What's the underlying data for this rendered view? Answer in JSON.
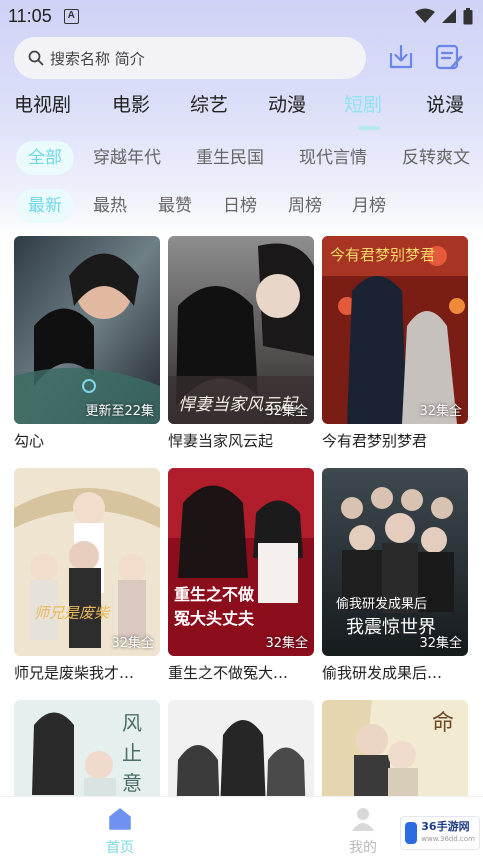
{
  "status_bar": {
    "time": "11:05",
    "notification_glyph": "A",
    "icons": [
      "wifi-icon",
      "signal-icon",
      "battery-icon"
    ]
  },
  "search": {
    "placeholder": "搜索名称 简介"
  },
  "header_icons": [
    "download-icon",
    "edit-list-icon"
  ],
  "category_tabs": [
    {
      "label": "电视剧",
      "active": false
    },
    {
      "label": "电影",
      "active": false
    },
    {
      "label": "综艺",
      "active": false
    },
    {
      "label": "动漫",
      "active": false
    },
    {
      "label": "短剧",
      "active": true
    },
    {
      "label": "说漫",
      "active": false
    }
  ],
  "genre_chips": [
    {
      "label": "全部",
      "active": true
    },
    {
      "label": "穿越年代",
      "active": false
    },
    {
      "label": "重生民国",
      "active": false
    },
    {
      "label": "现代言情",
      "active": false
    },
    {
      "label": "反转爽文",
      "active": false
    }
  ],
  "sort_chips": [
    {
      "label": "最新",
      "active": true
    },
    {
      "label": "最热",
      "active": false
    },
    {
      "label": "最赞",
      "active": false
    },
    {
      "label": "日榜",
      "active": false
    },
    {
      "label": "周榜",
      "active": false
    },
    {
      "label": "月榜",
      "active": false
    }
  ],
  "dramas": [
    {
      "title": "勾心",
      "badge": "更新至22集",
      "poster_text": "",
      "colors": [
        "#c7a47a",
        "#5a4a3f",
        "#2a2a2a"
      ]
    },
    {
      "title": "悍妻当家风云起",
      "badge": "32集全",
      "poster_text": "悍妻当家风云起",
      "colors": [
        "#8a8a8a",
        "#4a4040",
        "#d9d0c8"
      ]
    },
    {
      "title": "今有君梦别梦君",
      "badge": "32集全",
      "poster_text": "今有君梦别梦君",
      "colors": [
        "#b33a2a",
        "#1e2a3a",
        "#e2c35a"
      ]
    },
    {
      "title": "师兄是废柴我才…",
      "badge": "32集全",
      "poster_text": "师兄是废柴",
      "colors": [
        "#efe6d3",
        "#c89d6a",
        "#3b3b3b"
      ]
    },
    {
      "title": "重生之不做冤大…",
      "badge": "32集全",
      "poster_text": "重生之不做冤大头丈夫",
      "colors": [
        "#8c0d1c",
        "#d43040",
        "#f0e6e6"
      ]
    },
    {
      "title": "偷我研发成果后…",
      "badge": "32集全",
      "poster_text": "偷我研发成果后我震惊世界",
      "colors": [
        "#20282c",
        "#52616b",
        "#d2d6d8"
      ]
    },
    {
      "title": "",
      "badge": "",
      "poster_text": "风止意难平",
      "colors": [
        "#e6f0f0",
        "#7b9a98",
        "#2b2b2b"
      ]
    },
    {
      "title": "",
      "badge": "",
      "poster_text": "",
      "colors": [
        "#f2f2f2",
        "#c9c9c9",
        "#4a4a4a"
      ]
    },
    {
      "title": "",
      "badge": "",
      "poster_text": "命",
      "colors": [
        "#f4ecd6",
        "#c7a46a",
        "#2e2e2e"
      ]
    }
  ],
  "bottom_nav": [
    {
      "label": "首页",
      "icon": "home-icon",
      "active": true
    },
    {
      "label": "我的",
      "icon": "profile-icon",
      "active": false
    }
  ],
  "watermark": {
    "brand": "36手游网",
    "sub": "www.36dd.com"
  },
  "colors": {
    "accent": "#7ad9e6",
    "header_bg": "#d5d8f6"
  }
}
